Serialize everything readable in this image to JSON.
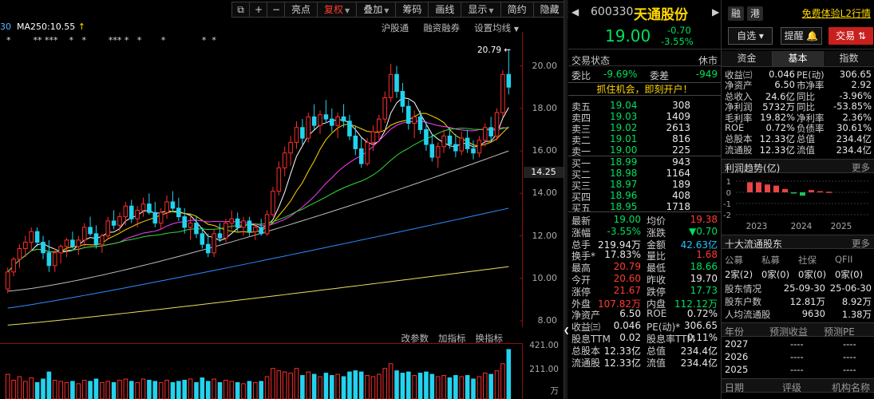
{
  "toolbar": {
    "items": [
      "⧉",
      "+",
      "−",
      "亮点",
      "复权",
      "叠加",
      "筹码",
      "画线",
      "显示",
      "简约",
      "隐藏",
      "❯❯"
    ]
  },
  "chart": {
    "ma_legend": {
      "ma30": "30",
      "ma250": "MA250:10.55",
      "arrow": "↑"
    },
    "stars_row": "*        ** ***    *   *        *** *   *       *             *  *",
    "links": [
      "沪股通",
      "融资融券",
      "设置均线"
    ],
    "high_note": "20.79 ←",
    "current_price_tag": "14.25",
    "vol_links": [
      "改参数",
      "加指标",
      "换指标"
    ],
    "vol_ticks": [
      "421.00",
      "211.00",
      "万"
    ]
  },
  "chart_data": {
    "type": "candlestick",
    "price_ticks": [
      20.0,
      18.0,
      16.0,
      14.0,
      12.0,
      10.0,
      8.0
    ],
    "ylim": [
      7.7,
      21.6
    ],
    "candles": [
      [
        9.5,
        10.5,
        9.3,
        10.3
      ],
      [
        10.3,
        11.0,
        10.1,
        10.9
      ],
      [
        10.9,
        11.6,
        10.5,
        11.4
      ],
      [
        11.4,
        12.0,
        11.0,
        11.7
      ],
      [
        11.7,
        12.4,
        11.3,
        12.2
      ],
      [
        12.2,
        12.4,
        11.5,
        11.7
      ],
      [
        11.7,
        12.0,
        10.9,
        11.2
      ],
      [
        11.2,
        11.8,
        10.3,
        10.6
      ],
      [
        10.6,
        11.4,
        10.3,
        11.2
      ],
      [
        11.2,
        11.6,
        10.7,
        11.5
      ],
      [
        11.5,
        11.9,
        11.0,
        11.8
      ],
      [
        11.8,
        12.2,
        11.4,
        11.5
      ],
      [
        11.5,
        12.0,
        11.1,
        11.8
      ],
      [
        11.8,
        12.6,
        11.5,
        12.4
      ],
      [
        12.4,
        12.9,
        12.0,
        12.1
      ],
      [
        12.1,
        12.5,
        11.4,
        11.6
      ],
      [
        11.6,
        12.1,
        11.2,
        12.0
      ],
      [
        12.0,
        12.9,
        11.8,
        12.7
      ],
      [
        12.7,
        13.2,
        12.3,
        12.5
      ],
      [
        12.5,
        13.1,
        12.2,
        12.9
      ],
      [
        12.9,
        13.6,
        12.5,
        13.4
      ],
      [
        13.4,
        13.7,
        12.6,
        12.8
      ],
      [
        12.8,
        13.4,
        12.4,
        13.2
      ],
      [
        13.2,
        13.8,
        12.9,
        13.5
      ],
      [
        13.5,
        14.0,
        13.0,
        13.1
      ],
      [
        13.1,
        13.6,
        12.4,
        12.6
      ],
      [
        12.6,
        13.3,
        12.3,
        13.1
      ],
      [
        13.1,
        13.9,
        12.8,
        13.6
      ],
      [
        13.6,
        14.1,
        13.1,
        13.3
      ],
      [
        13.3,
        13.8,
        12.7,
        12.9
      ],
      [
        12.9,
        13.3,
        12.1,
        12.4
      ],
      [
        12.4,
        12.9,
        11.8,
        12.6
      ],
      [
        12.6,
        12.9,
        11.9,
        12.1
      ],
      [
        12.1,
        12.4,
        11.4,
        11.6
      ],
      [
        11.6,
        12.1,
        11.0,
        11.2
      ],
      [
        11.2,
        12.3,
        11.0,
        12.1
      ],
      [
        12.1,
        12.6,
        11.7,
        11.9
      ],
      [
        11.9,
        12.8,
        11.7,
        12.6
      ],
      [
        12.6,
        13.2,
        12.3,
        12.8
      ],
      [
        12.8,
        13.1,
        12.2,
        12.4
      ],
      [
        12.4,
        12.9,
        12.0,
        12.7
      ],
      [
        12.7,
        12.9,
        12.0,
        12.2
      ],
      [
        12.2,
        12.6,
        11.8,
        12.4
      ],
      [
        12.4,
        12.8,
        12.0,
        12.1
      ],
      [
        12.1,
        13.2,
        12.0,
        13.0
      ],
      [
        13.0,
        14.3,
        12.9,
        14.1
      ],
      [
        14.1,
        15.5,
        13.9,
        15.2
      ],
      [
        15.2,
        16.2,
        14.8,
        15.9
      ],
      [
        15.9,
        16.7,
        15.3,
        16.4
      ],
      [
        16.4,
        17.4,
        16.1,
        17.1
      ],
      [
        17.1,
        17.5,
        16.3,
        16.6
      ],
      [
        16.6,
        17.8,
        16.4,
        17.6
      ],
      [
        17.6,
        18.2,
        17.0,
        17.2
      ],
      [
        17.2,
        17.9,
        16.8,
        17.7
      ],
      [
        17.7,
        18.4,
        17.3,
        17.5
      ],
      [
        17.5,
        18.0,
        16.9,
        17.2
      ],
      [
        17.2,
        17.8,
        16.6,
        17.6
      ],
      [
        17.6,
        18.2,
        17.1,
        17.4
      ],
      [
        17.4,
        17.7,
        16.5,
        16.7
      ],
      [
        16.7,
        17.2,
        15.8,
        16.1
      ],
      [
        16.1,
        16.6,
        15.2,
        15.4
      ],
      [
        15.4,
        16.6,
        15.3,
        16.4
      ],
      [
        16.4,
        17.2,
        16.0,
        16.9
      ],
      [
        16.9,
        17.7,
        16.5,
        17.5
      ],
      [
        17.5,
        18.8,
        17.3,
        18.5
      ],
      [
        18.5,
        20.1,
        18.3,
        19.6
      ],
      [
        19.6,
        20.0,
        18.5,
        18.8
      ],
      [
        18.8,
        19.2,
        17.8,
        18.1
      ],
      [
        18.1,
        18.4,
        17.0,
        17.3
      ],
      [
        17.3,
        17.9,
        16.6,
        17.6
      ],
      [
        17.6,
        17.9,
        16.8,
        17.0
      ],
      [
        17.0,
        17.4,
        16.0,
        16.3
      ],
      [
        16.3,
        16.8,
        15.5,
        15.7
      ],
      [
        15.7,
        16.4,
        15.2,
        16.2
      ],
      [
        16.2,
        17.0,
        15.9,
        16.7
      ],
      [
        16.7,
        17.1,
        16.1,
        16.3
      ],
      [
        16.3,
        16.8,
        15.7,
        16.0
      ],
      [
        16.0,
        16.9,
        15.8,
        16.6
      ],
      [
        16.6,
        17.0,
        15.9,
        16.1
      ],
      [
        16.1,
        16.5,
        15.6,
        15.9
      ],
      [
        15.9,
        16.7,
        15.7,
        16.5
      ],
      [
        16.5,
        17.3,
        16.2,
        17.1
      ],
      [
        17.1,
        17.6,
        16.5,
        16.7
      ],
      [
        16.7,
        18.0,
        16.5,
        17.8
      ],
      [
        17.8,
        19.8,
        17.6,
        19.6
      ],
      [
        19.6,
        20.79,
        18.66,
        19.0
      ]
    ],
    "ma_lines": [
      {
        "name": "ma5",
        "color": "#ffffff"
      },
      {
        "name": "ma10",
        "color": "#ffd800"
      },
      {
        "name": "ma20",
        "color": "#ff3cff"
      },
      {
        "name": "ma30",
        "color": "#33dd33"
      },
      {
        "name": "ma60",
        "color": "#bdbdbd"
      },
      {
        "name": "ma120",
        "color": "#2f8cff"
      },
      {
        "name": "ma250",
        "color": "#e8e060"
      }
    ],
    "volumes": [
      210,
      160,
      190,
      150,
      180,
      140,
      170,
      230,
      160,
      150,
      140,
      150,
      130,
      160,
      150,
      170,
      140,
      150,
      140,
      160,
      170,
      150,
      140,
      170,
      160,
      150,
      140,
      160,
      140,
      150,
      160,
      170,
      140,
      180,
      150,
      170,
      140,
      160,
      150,
      140,
      130,
      150,
      140,
      150,
      190,
      260,
      240,
      230,
      220,
      260,
      200,
      230,
      210,
      190,
      220,
      200,
      210,
      190,
      230,
      240,
      230,
      200,
      190,
      210,
      260,
      300,
      240,
      220,
      230,
      200,
      220,
      230,
      210,
      190,
      200,
      180,
      200,
      190,
      200,
      170,
      190,
      220,
      210,
      240,
      300,
      421
    ],
    "vol_ylim": [
      0,
      421
    ]
  },
  "quote": {
    "nav_left": "◀",
    "code": "600330",
    "name": "天通股份",
    "price": "19.00",
    "change": "-0.70",
    "change_pct": "-3.55%",
    "status_label": "交易状态",
    "status_value": "休市",
    "weibi_label": "委比",
    "weibi_value": "-9.69%",
    "weicha_label": "委差",
    "weicha_value": "-949",
    "promo": "抓住机会，即刻开户！",
    "asks": [
      {
        "label": "卖五",
        "price": "19.04",
        "vol": "308"
      },
      {
        "label": "卖四",
        "price": "19.03",
        "vol": "1409"
      },
      {
        "label": "卖三",
        "price": "19.02",
        "vol": "2613"
      },
      {
        "label": "卖二",
        "price": "19.01",
        "vol": "816"
      },
      {
        "label": "卖一",
        "price": "19.00",
        "vol": "225"
      }
    ],
    "bids": [
      {
        "label": "买一",
        "price": "18.99",
        "vol": "943"
      },
      {
        "label": "买二",
        "price": "18.98",
        "vol": "1164"
      },
      {
        "label": "买三",
        "price": "18.97",
        "vol": "189"
      },
      {
        "label": "买四",
        "price": "18.96",
        "vol": "408"
      },
      {
        "label": "买五",
        "price": "18.95",
        "vol": "1718"
      }
    ],
    "stats": [
      {
        "l1": "最新",
        "v1": "19.00",
        "c1": "grn",
        "l2": "均价",
        "v2": "19.38",
        "c2": "red"
      },
      {
        "l1": "涨幅",
        "v1": "-3.55%",
        "c1": "grn",
        "l2": "涨跌",
        "v2": "▼0.70",
        "c2": "grn"
      },
      {
        "l1": "总手",
        "v1": "219.94万",
        "c1": "wht",
        "l2": "金额",
        "v2": "42.63亿",
        "c2": "cyn"
      },
      {
        "l1": "换手*",
        "v1": "17.83%",
        "c1": "wht",
        "l2": "量比",
        "v2": "1.68",
        "c2": "red"
      },
      {
        "l1": "最高",
        "v1": "20.79",
        "c1": "red",
        "l2": "最低",
        "v2": "18.66",
        "c2": "grn"
      },
      {
        "l1": "今开",
        "v1": "20.60",
        "c1": "red",
        "l2": "昨收",
        "v2": "19.70",
        "c2": "wht"
      },
      {
        "l1": "涨停",
        "v1": "21.67",
        "c1": "red",
        "l2": "跌停",
        "v2": "17.73",
        "c2": "grn"
      },
      {
        "l1": "外盘",
        "v1": "107.82万",
        "c1": "red",
        "l2": "内盘",
        "v2": "112.12万",
        "c2": "grn"
      },
      {
        "l1": "净资产",
        "v1": "6.50",
        "c1": "wht",
        "l2": "ROE",
        "v2": "0.72%",
        "c2": "wht"
      },
      {
        "l1": "收益㈢",
        "v1": "0.046",
        "c1": "wht",
        "l2": "PE(动)*",
        "v2": "306.65",
        "c2": "wht"
      },
      {
        "l1": "股息TTM",
        "v1": "0.02",
        "c1": "wht",
        "l2": "股息率TTM",
        "v2": "0.11%",
        "c2": "wht"
      },
      {
        "l1": "总股本",
        "v1": "12.33亿",
        "c1": "wht",
        "l2": "总值",
        "v2": "234.4亿",
        "c2": "wht"
      },
      {
        "l1": "流通股",
        "v1": "12.33亿",
        "c1": "wht",
        "l2": "流值",
        "v2": "234.4亿",
        "c2": "wht"
      }
    ]
  },
  "right": {
    "nav_right": "▶",
    "badges": [
      "融",
      "港"
    ],
    "free_trial": "免费体验L2行情",
    "btn_zixuan": "自选 ▾",
    "btn_tixing": "提醒 🔔",
    "btn_jiaoyi": "交易 ⇅",
    "tabs": [
      "资金",
      "基本",
      "指数"
    ],
    "fundamentals": [
      {
        "l1": "收益㈢",
        "v1": "0.046",
        "l2": "PE(动)",
        "v2": "306.65"
      },
      {
        "l1": "净资产",
        "v1": "6.50",
        "l2": "市净率",
        "v2": "2.92"
      },
      {
        "l1": "总收入",
        "v1": "24.6亿",
        "l2": "同比",
        "v2": "-3.96%"
      },
      {
        "l1": "净利润",
        "v1": "5732万",
        "l2": "同比",
        "v2": "-53.85%"
      },
      {
        "l1": "毛利率",
        "v1": "19.82%",
        "l2": "净利率",
        "v2": "2.36%"
      },
      {
        "l1": "ROE",
        "v1": "0.72%",
        "l2": "负债率",
        "v2": "30.61%"
      },
      {
        "l1": "总股本",
        "v1": "12.33亿",
        "l2": "总值",
        "v2": "234.4亿"
      },
      {
        "l1": "流通股",
        "v1": "12.33亿",
        "l2": "流值",
        "v2": "234.4亿"
      }
    ],
    "profit_title": "利润趋势(亿)",
    "more": "更多",
    "profit_yticks": [
      "1",
      "0",
      "-1",
      "-2"
    ],
    "profit_years": [
      "2023",
      "2024",
      "2025"
    ],
    "profit_bars": [
      0.9,
      0.9,
      0.7,
      0.6,
      0.3,
      -0.1,
      -0.3,
      0.2,
      0.1,
      0.05
    ],
    "holders_title": "十大流通股东",
    "holder_types": [
      "公募",
      "私募",
      "社保",
      "QFII"
    ],
    "holder_counts": [
      "2家(2)",
      "0家(0)",
      "0家(0)",
      "0家(0)"
    ],
    "holder_rows": [
      {
        "l": "股东情况",
        "a": "25-09-30",
        "b": "25-06-30"
      },
      {
        "l": "股东户数",
        "a": "12.81万",
        "b": "8.92万"
      },
      {
        "l": "人均流通股",
        "a": "9630",
        "b": "1.38万"
      }
    ],
    "forecast_head": [
      "年份",
      "预测收益",
      "预测PE"
    ],
    "forecast_rows": [
      {
        "y": "2027",
        "a": "----",
        "b": "----"
      },
      {
        "y": "2026",
        "a": "----",
        "b": "----"
      },
      {
        "y": "2025",
        "a": "----",
        "b": "----"
      }
    ],
    "rating_head": [
      "日期",
      "评级",
      "机构名称"
    ]
  }
}
